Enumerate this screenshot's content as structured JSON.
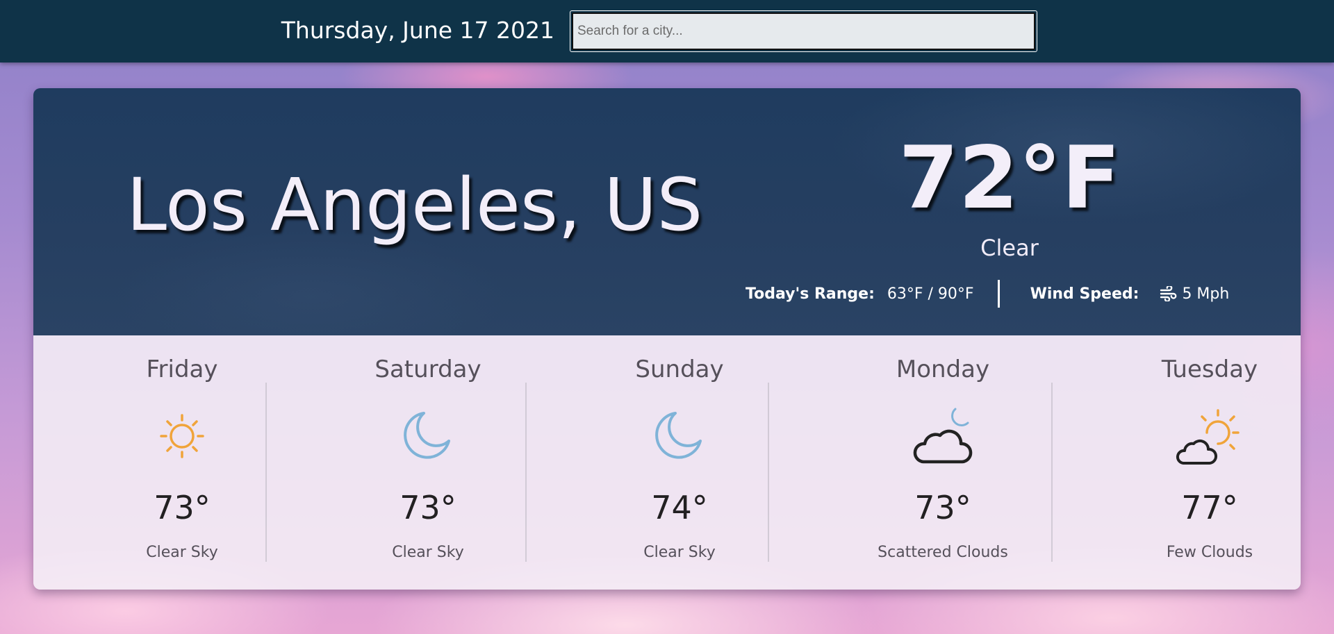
{
  "header": {
    "date": "Thursday, June 17 2021",
    "search_placeholder": "Search for a city..."
  },
  "current": {
    "city": "Los Angeles, US",
    "temperature": "72°F",
    "condition": "Clear",
    "range_label": "Today's Range:",
    "range_value": "63°F / 90°F",
    "wind_label": "Wind Speed:",
    "wind_value": "5 Mph",
    "wind_icon": "wind-icon"
  },
  "forecast": [
    {
      "day": "Friday",
      "icon": "sun-icon",
      "temp": "73°",
      "desc": "Clear Sky"
    },
    {
      "day": "Saturday",
      "icon": "moon-icon",
      "temp": "73°",
      "desc": "Clear Sky"
    },
    {
      "day": "Sunday",
      "icon": "moon-icon",
      "temp": "74°",
      "desc": "Clear Sky"
    },
    {
      "day": "Monday",
      "icon": "cloud-moon-icon",
      "temp": "73°",
      "desc": "Scattered Clouds"
    },
    {
      "day": "Tuesday",
      "icon": "sun-cloud-icon",
      "temp": "77°",
      "desc": "Few Clouds"
    }
  ],
  "colors": {
    "topbar": "#0f3348",
    "hero": "#243f60",
    "sun": "#f0a43a",
    "moon": "#7fb3d8",
    "cloud": "#222222"
  }
}
